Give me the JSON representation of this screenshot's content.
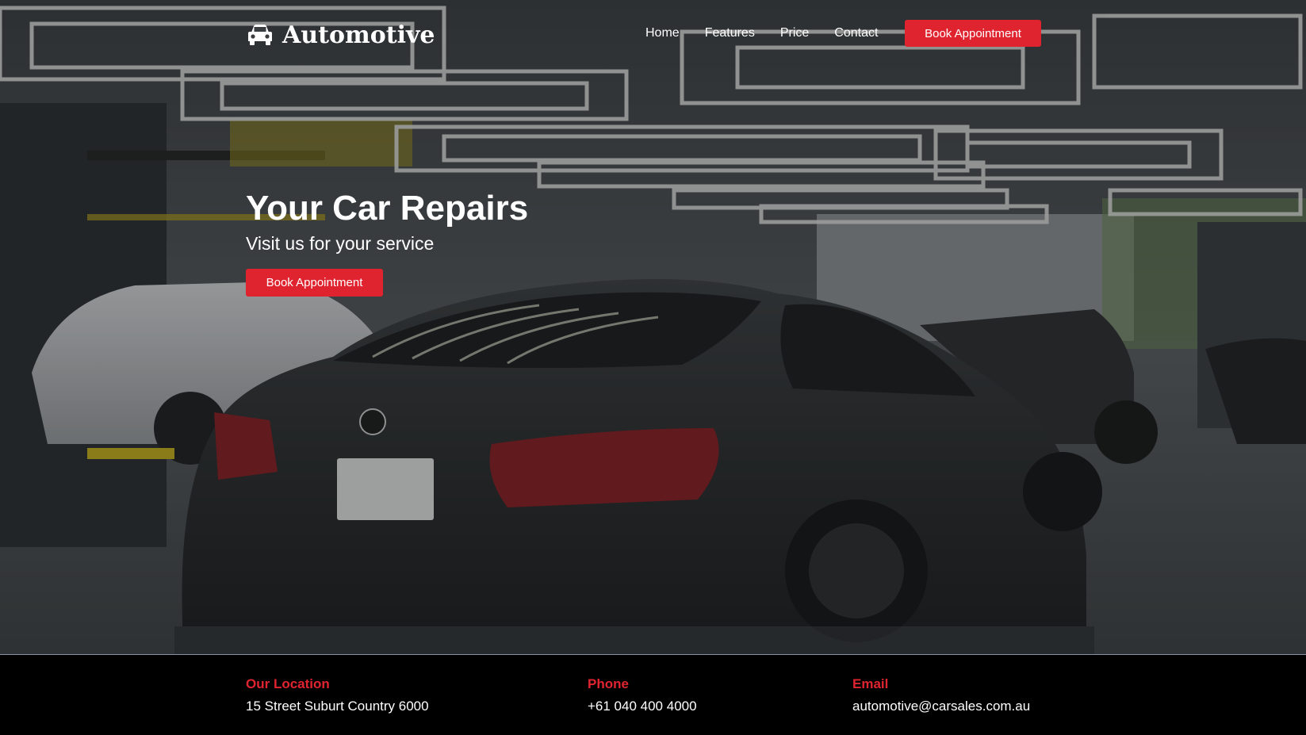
{
  "brand": {
    "name": "Automotive",
    "icon": "car-icon"
  },
  "nav": {
    "links": [
      "Home",
      "Features",
      "Price",
      "Contact"
    ],
    "cta_label": "Book Appointment"
  },
  "hero": {
    "title": "Your Car Repairs",
    "subtitle": "Visit us for your service",
    "cta_label": "Book Appointment",
    "image": "dark-sports-car-in-garage"
  },
  "info": [
    {
      "label": "Our Location",
      "value": "15 Street Suburt Country 6000"
    },
    {
      "label": "Phone",
      "value": "+61 040 400 4000"
    },
    {
      "label": "Email",
      "value": "automotive@carsales.com.au"
    }
  ],
  "colors": {
    "accent": "#e0242f",
    "info_bar_bg": "#000000",
    "text": "#ffffff"
  }
}
